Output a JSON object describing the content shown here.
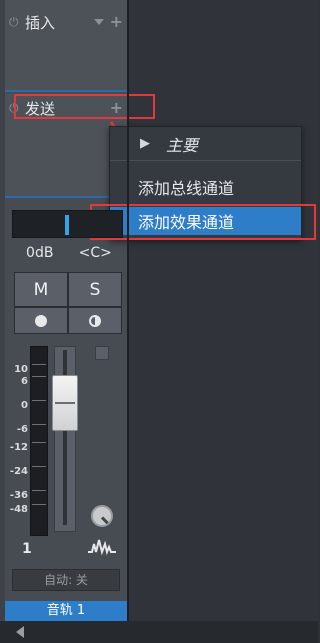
{
  "insert": {
    "label": "插入"
  },
  "send": {
    "label": "发送"
  },
  "menu": {
    "header": "主要",
    "items": [
      {
        "label": "添加总线通道"
      },
      {
        "label": "添加效果通道"
      }
    ]
  },
  "channel": {
    "volume": "0dB",
    "pan": "<C>",
    "mute": "M",
    "solo": "S",
    "scale": [
      "10",
      "6",
      "0",
      "-6",
      "-12",
      "-24",
      "-36",
      "-48"
    ],
    "number": "1",
    "automation": "自动: 关",
    "name": "音轨 1"
  },
  "colors": {
    "accent": "#2d7dc8",
    "highlight": "#e03a3a"
  }
}
